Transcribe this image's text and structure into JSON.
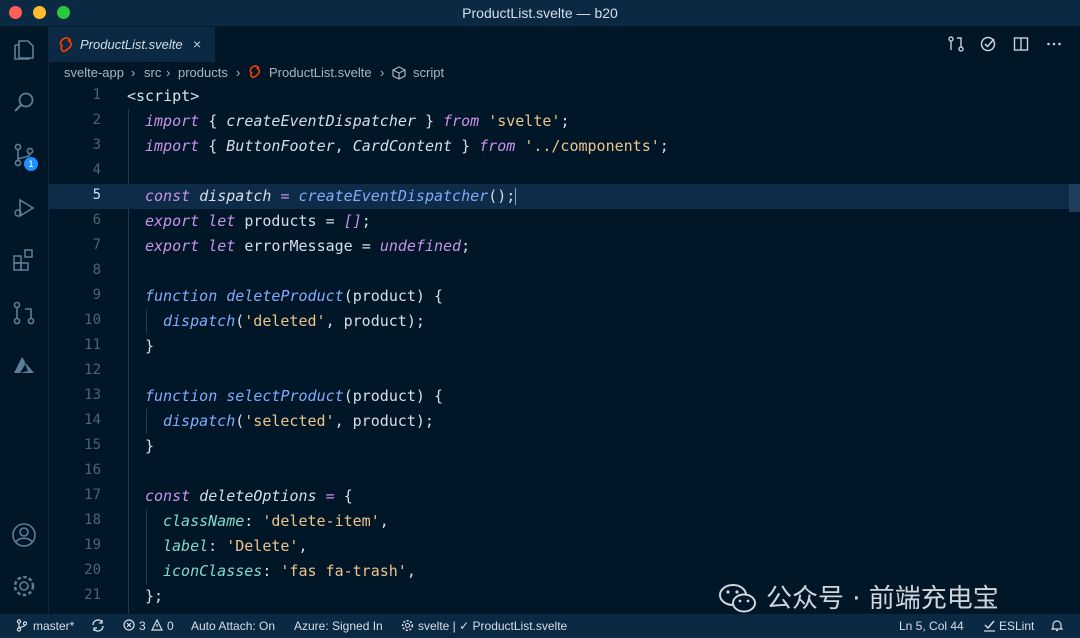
{
  "window": {
    "title": "ProductList.svelte — b20"
  },
  "activity_bar": {
    "scm_badge": "1"
  },
  "tab": {
    "label": "ProductList.svelte",
    "close": "×"
  },
  "breadcrumb": {
    "items": [
      "svelte-app",
      "src",
      "products",
      "ProductList.svelte",
      "script"
    ],
    "separator": "›"
  },
  "editor": {
    "current_line": 5,
    "lines": [
      {
        "n": "1"
      },
      {
        "n": "2"
      },
      {
        "n": "3"
      },
      {
        "n": "4"
      },
      {
        "n": "5"
      },
      {
        "n": "6"
      },
      {
        "n": "7"
      },
      {
        "n": "8"
      },
      {
        "n": "9"
      },
      {
        "n": "10"
      },
      {
        "n": "11"
      },
      {
        "n": "12"
      },
      {
        "n": "13"
      },
      {
        "n": "14"
      },
      {
        "n": "15"
      },
      {
        "n": "16"
      },
      {
        "n": "17"
      },
      {
        "n": "18"
      },
      {
        "n": "19"
      },
      {
        "n": "20"
      },
      {
        "n": "21"
      }
    ],
    "tokens": {
      "l1": [
        "<",
        "script",
        ">"
      ],
      "l2": [
        "import",
        " { ",
        "createEventDispatcher",
        " } ",
        "from",
        " ",
        "'svelte'",
        ";"
      ],
      "l3": [
        "import",
        " { ",
        "ButtonFooter",
        ", ",
        "CardContent",
        " } ",
        "from",
        " ",
        "'../components'",
        ";"
      ],
      "l5": [
        "const",
        " ",
        "dispatch",
        " = ",
        "createEventDispatcher",
        "();"
      ],
      "l6": [
        "export",
        " ",
        "let",
        " products = ",
        "[]",
        ";"
      ],
      "l7": [
        "export",
        " ",
        "let",
        " errorMessage = ",
        "undefined",
        ";"
      ],
      "l9": [
        "function",
        " ",
        "deleteProduct",
        "(product) {"
      ],
      "l10": [
        "dispatch",
        "(",
        "'deleted'",
        ", product);"
      ],
      "l11": [
        "}"
      ],
      "l13": [
        "function",
        " ",
        "selectProduct",
        "(product) {"
      ],
      "l14": [
        "dispatch",
        "(",
        "'selected'",
        ", product);"
      ],
      "l15": [
        "}"
      ],
      "l17": [
        "const",
        " ",
        "deleteOptions",
        " = ",
        "{"
      ],
      "l18": [
        "className",
        ": ",
        "'delete-item'",
        ","
      ],
      "l19": [
        "label",
        ": ",
        "'Delete'",
        ","
      ],
      "l20": [
        "iconClasses",
        ": ",
        "'fas fa-trash'",
        ","
      ],
      "l21": [
        "};"
      ]
    }
  },
  "statusbar": {
    "branch": "master*",
    "errors": "3",
    "warnings": "0",
    "auto_attach": "Auto Attach: On",
    "azure": "Azure: Signed In",
    "svelte": "svelte | ✓ ProductList.svelte",
    "position": "Ln 5, Col 44",
    "eslint": "ESLint"
  },
  "watermark": {
    "text": "公众号 · 前端充电宝"
  },
  "colors": {
    "background": "#011627",
    "keyword": "#c792ea",
    "function": "#82aaff",
    "string": "#ecc48d",
    "property": "#7fdbca"
  }
}
